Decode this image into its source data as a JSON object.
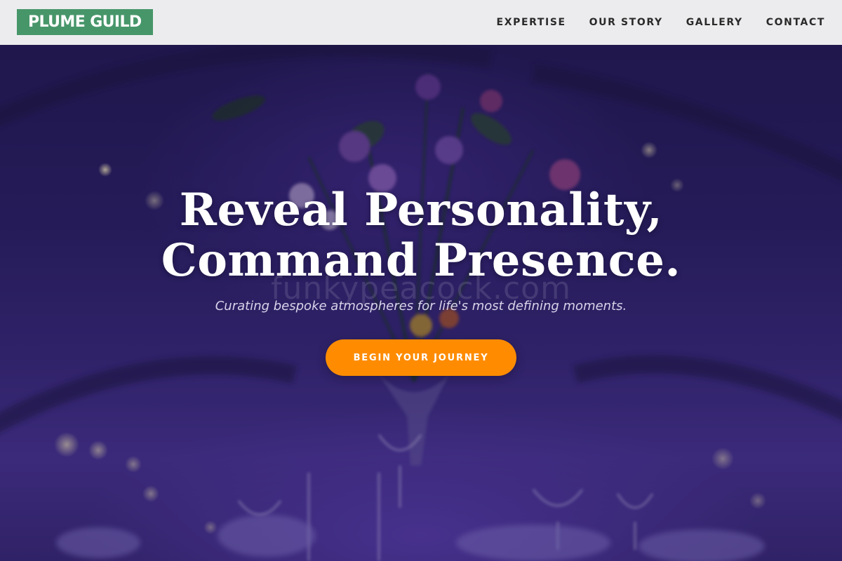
{
  "header": {
    "logo": "PLUME GUILD",
    "nav": [
      "EXPERTISE",
      "OUR STORY",
      "GALLERY",
      "CONTACT"
    ]
  },
  "hero": {
    "headline_line1": "Reveal Personality,",
    "headline_line2": "Command Presence.",
    "watermark": "funkypeacock.com",
    "tagline": "Curating bespoke atmospheres for life's most defining moments.",
    "cta_label": "BEGIN YOUR JOURNEY",
    "background_image": "purple-lit-banquet-table-with-floral-centerpiece"
  },
  "colors": {
    "nav_bg": "#ececee",
    "logo_bg": "#47966a",
    "cta_bg": "#ff8c00",
    "hero_tint": "#2c2168"
  }
}
